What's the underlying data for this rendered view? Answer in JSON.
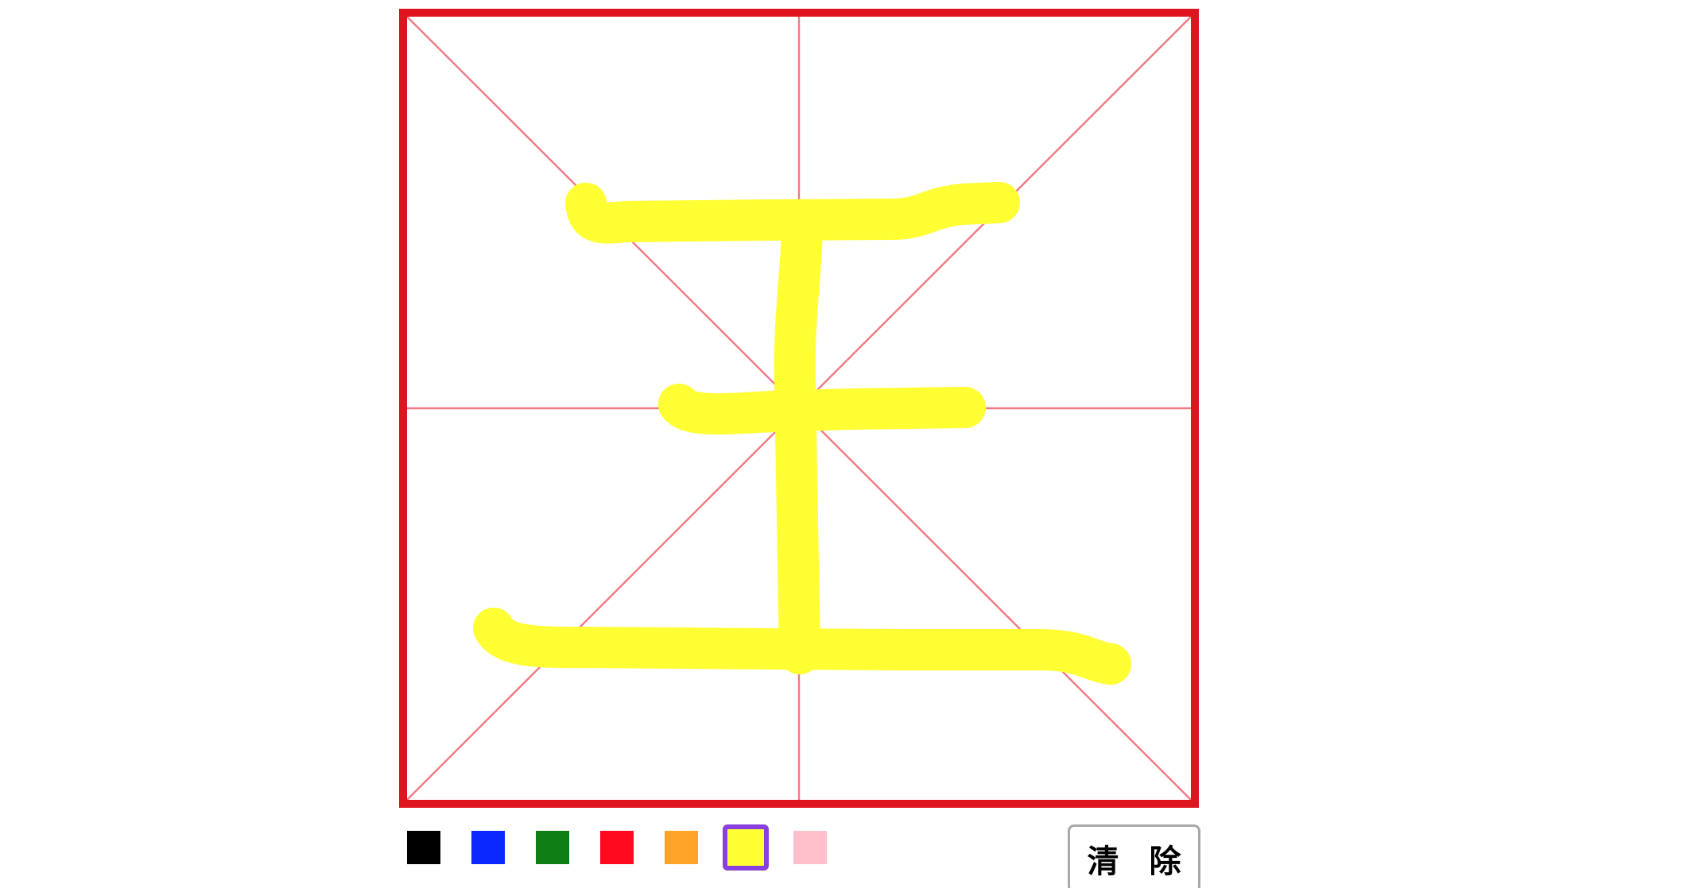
{
  "board": {
    "border_color": "#e0141e",
    "guide_color": "#f07a82",
    "ink_color": "#ffff33"
  },
  "palette": [
    {
      "name": "black",
      "color": "#000000",
      "selected": false
    },
    {
      "name": "blue",
      "color": "#0a28ff",
      "selected": false
    },
    {
      "name": "green",
      "color": "#0e7d14",
      "selected": false
    },
    {
      "name": "red",
      "color": "#ff0a1e",
      "selected": false
    },
    {
      "name": "orange",
      "color": "#ffa428",
      "selected": false
    },
    {
      "name": "yellow",
      "color": "#ffff33",
      "selected": true
    },
    {
      "name": "pink",
      "color": "#ffc0cb",
      "selected": false
    }
  ],
  "selection_color": "#8a3fe0",
  "clear_button": {
    "label": "清 除"
  }
}
